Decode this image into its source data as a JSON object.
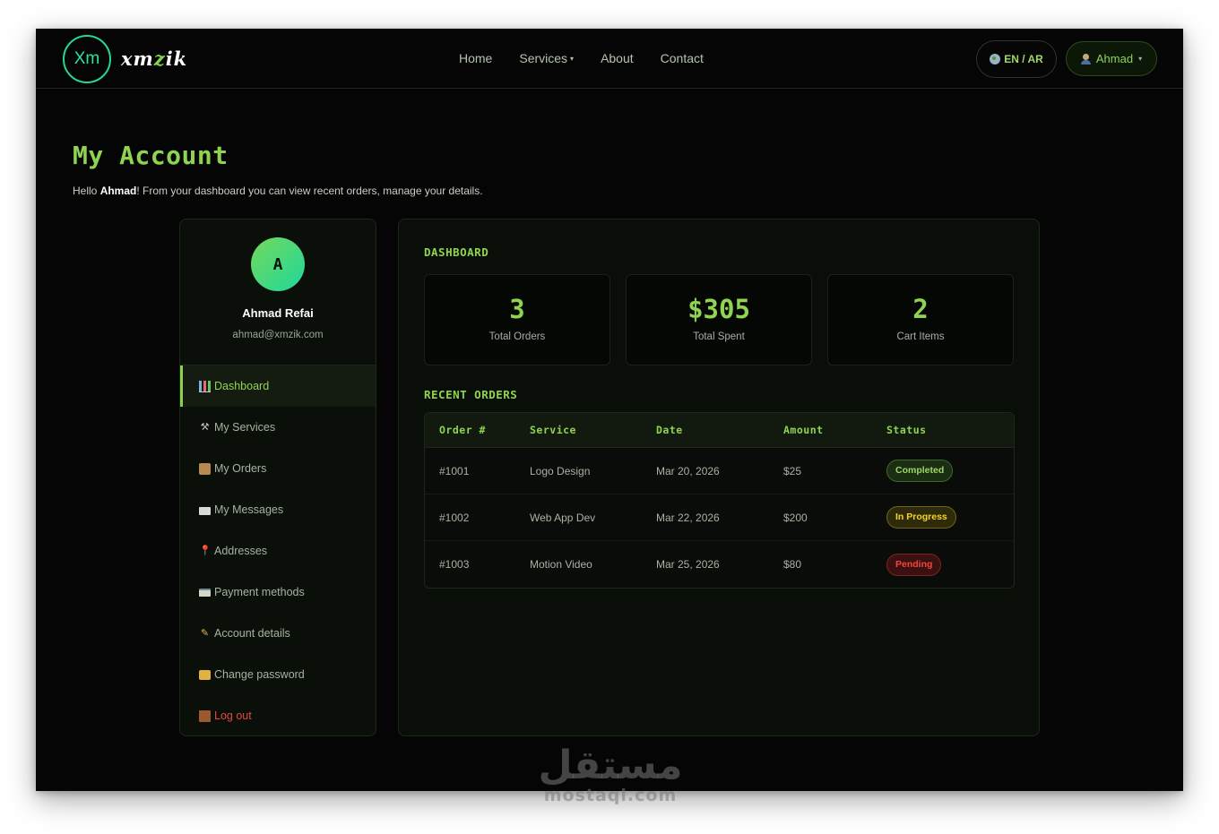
{
  "header": {
    "logo_mark": "Xm",
    "logo_text_a": "xm",
    "logo_text_z": "z",
    "logo_text_b": "ik",
    "nav": [
      "Home",
      "Services",
      "About",
      "Contact"
    ],
    "lang_label": "EN / AR",
    "user_label": "Ahmad"
  },
  "page": {
    "title": "My Account",
    "greeting_prefix": "Hello ",
    "greeting_name": "Ahmad",
    "greeting_suffix": "! From your dashboard you can view recent orders, manage your details."
  },
  "sidebar": {
    "avatar_initial": "A",
    "name": "Ahmad Refai",
    "email": "ahmad@xmzik.com",
    "items": [
      {
        "label": "Dashboard",
        "icon": "chart-icon"
      },
      {
        "label": "My Services",
        "icon": "tools-icon"
      },
      {
        "label": "My Orders",
        "icon": "package-icon"
      },
      {
        "label": "My Messages",
        "icon": "envelope-icon"
      },
      {
        "label": "Addresses",
        "icon": "pin-icon"
      },
      {
        "label": "Payment methods",
        "icon": "card-icon"
      },
      {
        "label": "Account details",
        "icon": "pencil-icon"
      },
      {
        "label": "Change password",
        "icon": "lock-icon"
      },
      {
        "label": "Log out",
        "icon": "door-icon"
      }
    ]
  },
  "dashboard": {
    "title": "DASHBOARD",
    "stats": [
      {
        "value": "3",
        "label": "Total Orders"
      },
      {
        "value": "$305",
        "label": "Total Spent"
      },
      {
        "value": "2",
        "label": "Cart Items"
      }
    ],
    "recent_title": "RECENT ORDERS",
    "columns": [
      "Order #",
      "Service",
      "Date",
      "Amount",
      "Status"
    ],
    "rows": [
      {
        "order": "#1001",
        "service": "Logo Design",
        "date": "Mar 20, 2026",
        "amount": "$25",
        "status": "Completed"
      },
      {
        "order": "#1002",
        "service": "Web App Dev",
        "date": "Mar 22, 2026",
        "amount": "$200",
        "status": "In Progress"
      },
      {
        "order": "#1003",
        "service": "Motion Video",
        "date": "Mar 25, 2026",
        "amount": "$80",
        "status": "Pending"
      }
    ]
  },
  "watermark": {
    "arabic": "مستقل",
    "latin": "mostaql.com"
  },
  "colors": {
    "accent": "#8fd450",
    "teal": "#27d88e",
    "background": "#040504",
    "completed": "#9bd866",
    "in_progress": "#f1d52c",
    "pending": "#f2453d",
    "logout": "#e24b3e"
  }
}
